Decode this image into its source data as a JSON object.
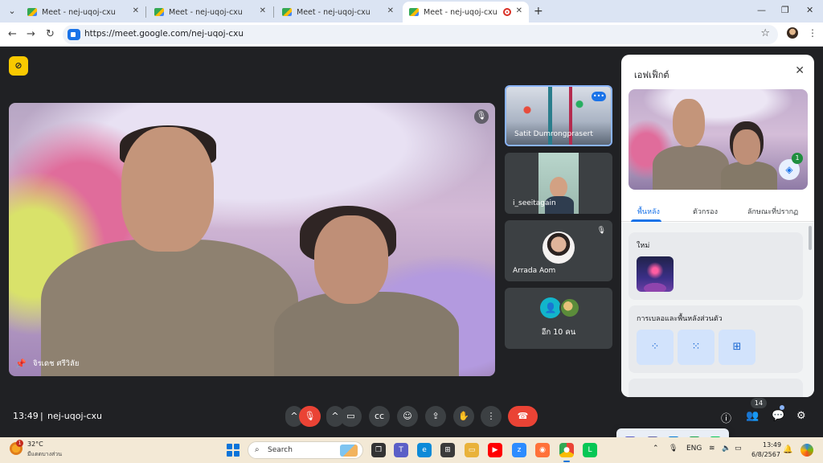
{
  "browser": {
    "tabs": [
      {
        "title": "Meet - nej-uqoj-cxu"
      },
      {
        "title": "Meet - nej-uqoj-cxu"
      },
      {
        "title": "Meet - nej-uqoj-cxu"
      },
      {
        "title": "Meet - nej-uqoj-cxu",
        "active": true,
        "recording": true
      }
    ],
    "url": "https://meet.google.com/nej-uqoj-cxu"
  },
  "meet": {
    "main_speaker": "จิรเดช ศรีวิลัย",
    "tiles": [
      {
        "name": "Satit Dumrongprasert",
        "selected": true
      },
      {
        "name": "i_seeitagain"
      },
      {
        "name": "Arrada Aom",
        "muted": true
      },
      {
        "name": "อีก 10 คน"
      }
    ],
    "time": "13:49",
    "separator": "|",
    "meeting_code": "nej-uqoj-cxu",
    "participant_count": "14"
  },
  "effects_panel": {
    "title": "เอฟเฟ็กต์",
    "layers_badge": "1",
    "tabs": [
      "พื้นหลัง",
      "ตัวกรอง",
      "ลักษณะที่ปรากฏ"
    ],
    "active_tab": "พื้นหลัง",
    "section_new": "ใหม่",
    "section_blur": "การเบลอและพื้นหลังส่วนตัว"
  },
  "taskbar": {
    "weather_temp": "32°C",
    "weather_desc": "มีแดดบางส่วน",
    "weather_badge": "1",
    "search_placeholder": "Search",
    "language": "ENG",
    "time": "13:49",
    "date": "6/8/2567"
  },
  "colors": {
    "accent": "#1a73e8",
    "danger": "#ea4335",
    "stage_bg": "#202124",
    "control_bg": "#3c4043"
  }
}
